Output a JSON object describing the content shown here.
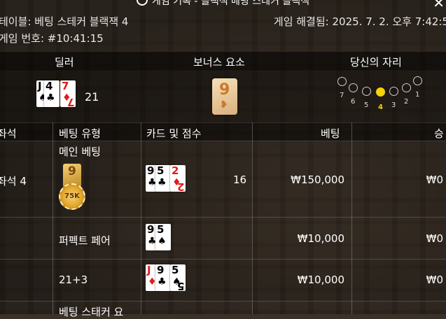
{
  "header": {
    "title": "게임 기록 - 블랙잭 베팅 스테커 블랙잭",
    "table_name": "테이블: 베팅 스테커 블랙잭 4",
    "resolved": "게임 해결됨: 2025. 7. 2. 오후 7:42:5",
    "round_id": "게임 번호: #10:41:15"
  },
  "sections": {
    "dealer": "딜러",
    "bonus": "보너스 요소",
    "your_seat": "당신의 자리"
  },
  "dealer": {
    "cards": [
      {
        "rank": "J",
        "suit": "♠",
        "color": "black"
      },
      {
        "rank": "4",
        "suit": "♣",
        "color": "black"
      },
      {
        "rank": "7",
        "suit": "♦",
        "color": "red"
      }
    ],
    "score": "21"
  },
  "bonus": {
    "value": "9",
    "symbol": "❥"
  },
  "seats": {
    "labels": [
      "7",
      "6",
      "5",
      "4",
      "3",
      "2",
      "1"
    ],
    "active": "4"
  },
  "table": {
    "headers": [
      "좌석",
      "베팅 유형",
      "카드 및 점수",
      "베팅",
      "승"
    ],
    "seat_label": "좌석 4",
    "rows": [
      {
        "type": "메인 베팅",
        "cards": [
          {
            "rank": "9",
            "suit": "♣",
            "color": "black"
          },
          {
            "rank": "5",
            "suit": "♣",
            "color": "black"
          },
          {
            "rank": "2",
            "suit": "♦",
            "color": "red"
          }
        ],
        "score": "16",
        "bet": "₩150,000",
        "win": "₩0",
        "chip": {
          "tile": "9",
          "value": "75K"
        }
      },
      {
        "type": "퍼펙트 페어",
        "cards": [
          {
            "rank": "9",
            "suit": "♣",
            "color": "black"
          },
          {
            "rank": "5",
            "suit": "♠",
            "color": "black"
          }
        ],
        "score": "",
        "bet": "₩10,000",
        "win": "₩0"
      },
      {
        "type": "21+3",
        "cards": [
          {
            "rank": "J",
            "suit": "♦",
            "color": "red"
          },
          {
            "rank": "9",
            "suit": "♣",
            "color": "black"
          },
          {
            "rank": "5",
            "suit": "♠",
            "color": "black"
          }
        ],
        "score": "",
        "bet": "₩10,000",
        "win": "₩0"
      },
      {
        "type": "베팅 스태커 요"
      }
    ]
  }
}
